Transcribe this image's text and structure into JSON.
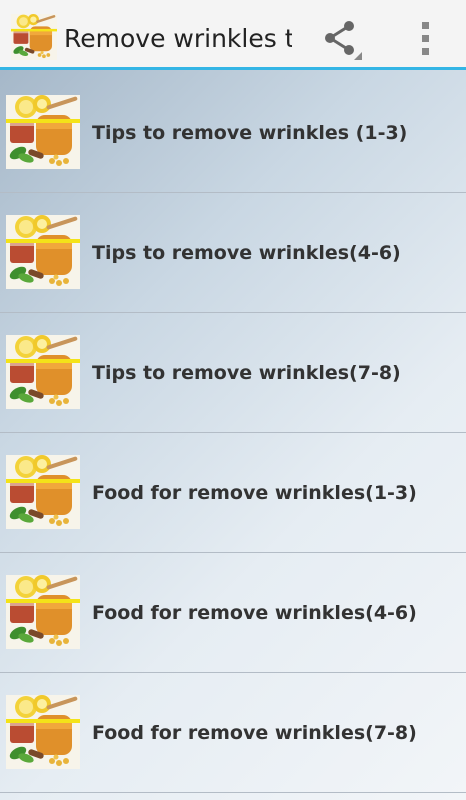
{
  "actionbar": {
    "title": "Remove wrinkles tips",
    "app_icon": "honey-lemon-icon",
    "share_icon": "share-icon",
    "overflow_icon": "overflow-menu-icon"
  },
  "colors": {
    "accent": "#33b5e5",
    "actionbar_bg": "#f4f4f4",
    "text": "#333333"
  },
  "items": [
    {
      "label": "Tips to remove wrinkles (1-3)"
    },
    {
      "label": "Tips to remove wrinkles(4-6)"
    },
    {
      "label": "Tips to remove wrinkles(7-8)"
    },
    {
      "label": "Food for remove wrinkles(1-3)"
    },
    {
      "label": "Food for remove wrinkles(4-6)"
    },
    {
      "label": "Food for remove wrinkles(7-8)"
    }
  ]
}
